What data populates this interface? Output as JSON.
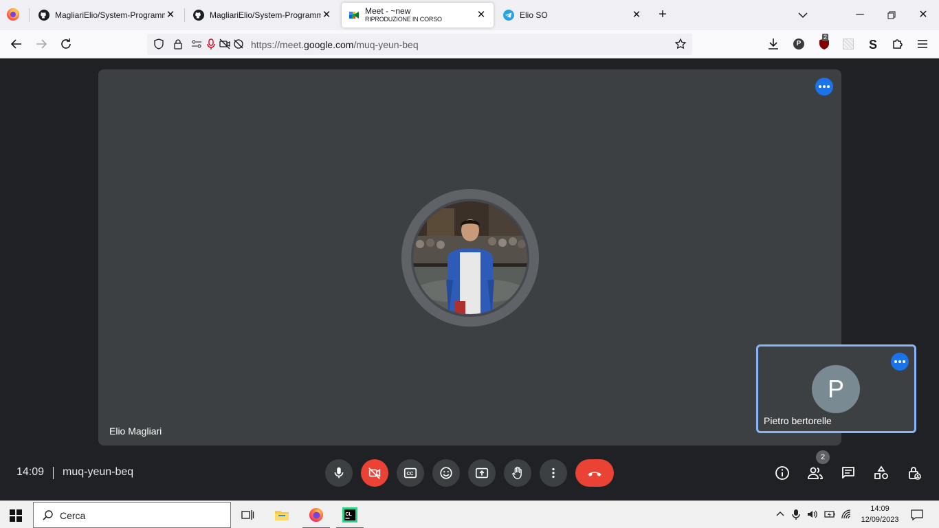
{
  "browser": {
    "tabs": [
      {
        "title": "MagliariElio/System-Programm",
        "icon": "github-icon"
      },
      {
        "title": "MagliariElio/System-Programm",
        "icon": "github-icon"
      },
      {
        "title": "Meet - ~new",
        "subtitle": "RIPRODUZIONE IN CORSO",
        "icon": "meet-icon",
        "active": true
      },
      {
        "title": "Elio SO",
        "icon": "telegram-icon"
      }
    ],
    "url": {
      "prefix": "https://meet.",
      "domain": "google.com",
      "path": "/muq-yeun-beq"
    },
    "extension_badge": "2",
    "profile_letter": "P"
  },
  "meet": {
    "main_participant": "Elio Magliari",
    "tile_participant": "Pietro bertorelle",
    "tile_initial": "P",
    "clock": "14:09",
    "meeting_code": "muq-yeun-beq",
    "participants_count": "2",
    "colors": {
      "accent": "#1a73e8",
      "danger": "#ea4335",
      "surface": "#3c4043",
      "background": "#202124",
      "highlight": "#8ab4f8"
    }
  },
  "taskbar": {
    "search_placeholder": "Cerca",
    "time": "14:09",
    "date": "12/09/2023"
  }
}
